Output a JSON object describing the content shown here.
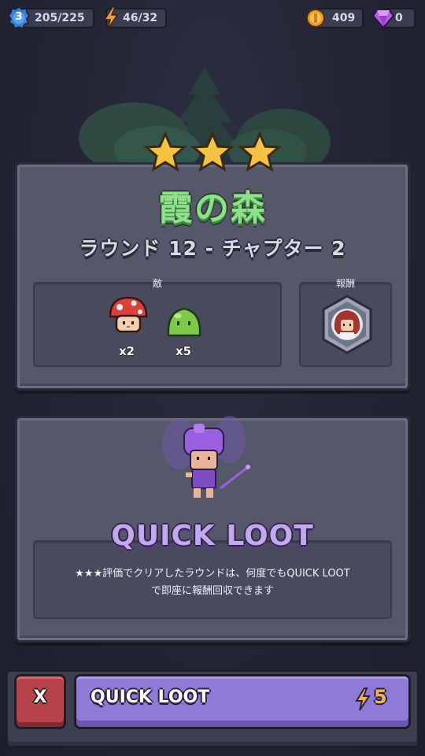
{
  "topbar": {
    "level": "3",
    "xp": "205/225",
    "energy": "46/32",
    "coins": "409",
    "gems": "0"
  },
  "stage": {
    "stars": 3,
    "title": "霞の森",
    "subtitle": "ラウンド 12 - チャプター 2"
  },
  "enemies": {
    "label": "敵",
    "items": [
      {
        "icon": "mushroom-enemy-icon",
        "count": "x2"
      },
      {
        "icon": "slime-enemy-icon",
        "count": "x5"
      }
    ]
  },
  "rewards": {
    "label": "報酬",
    "icon": "character-portrait-reward-icon"
  },
  "quick_loot": {
    "title": "QUICK LOOT",
    "description_line1": "★★★評価でクリアしたラウンドは、何度でもQUICK LOOT",
    "description_line2": "で即座に報酬回収できます"
  },
  "bottom": {
    "close_label": "X",
    "button_label": "QUICK LOOT",
    "cost": "5"
  },
  "colors": {
    "title_green": "#8fe08a",
    "accent_purple": "#8f7ad6",
    "close_red": "#b8434b",
    "energy_orange": "#f5b24a",
    "panel": "#55586b",
    "background": "#232534"
  }
}
